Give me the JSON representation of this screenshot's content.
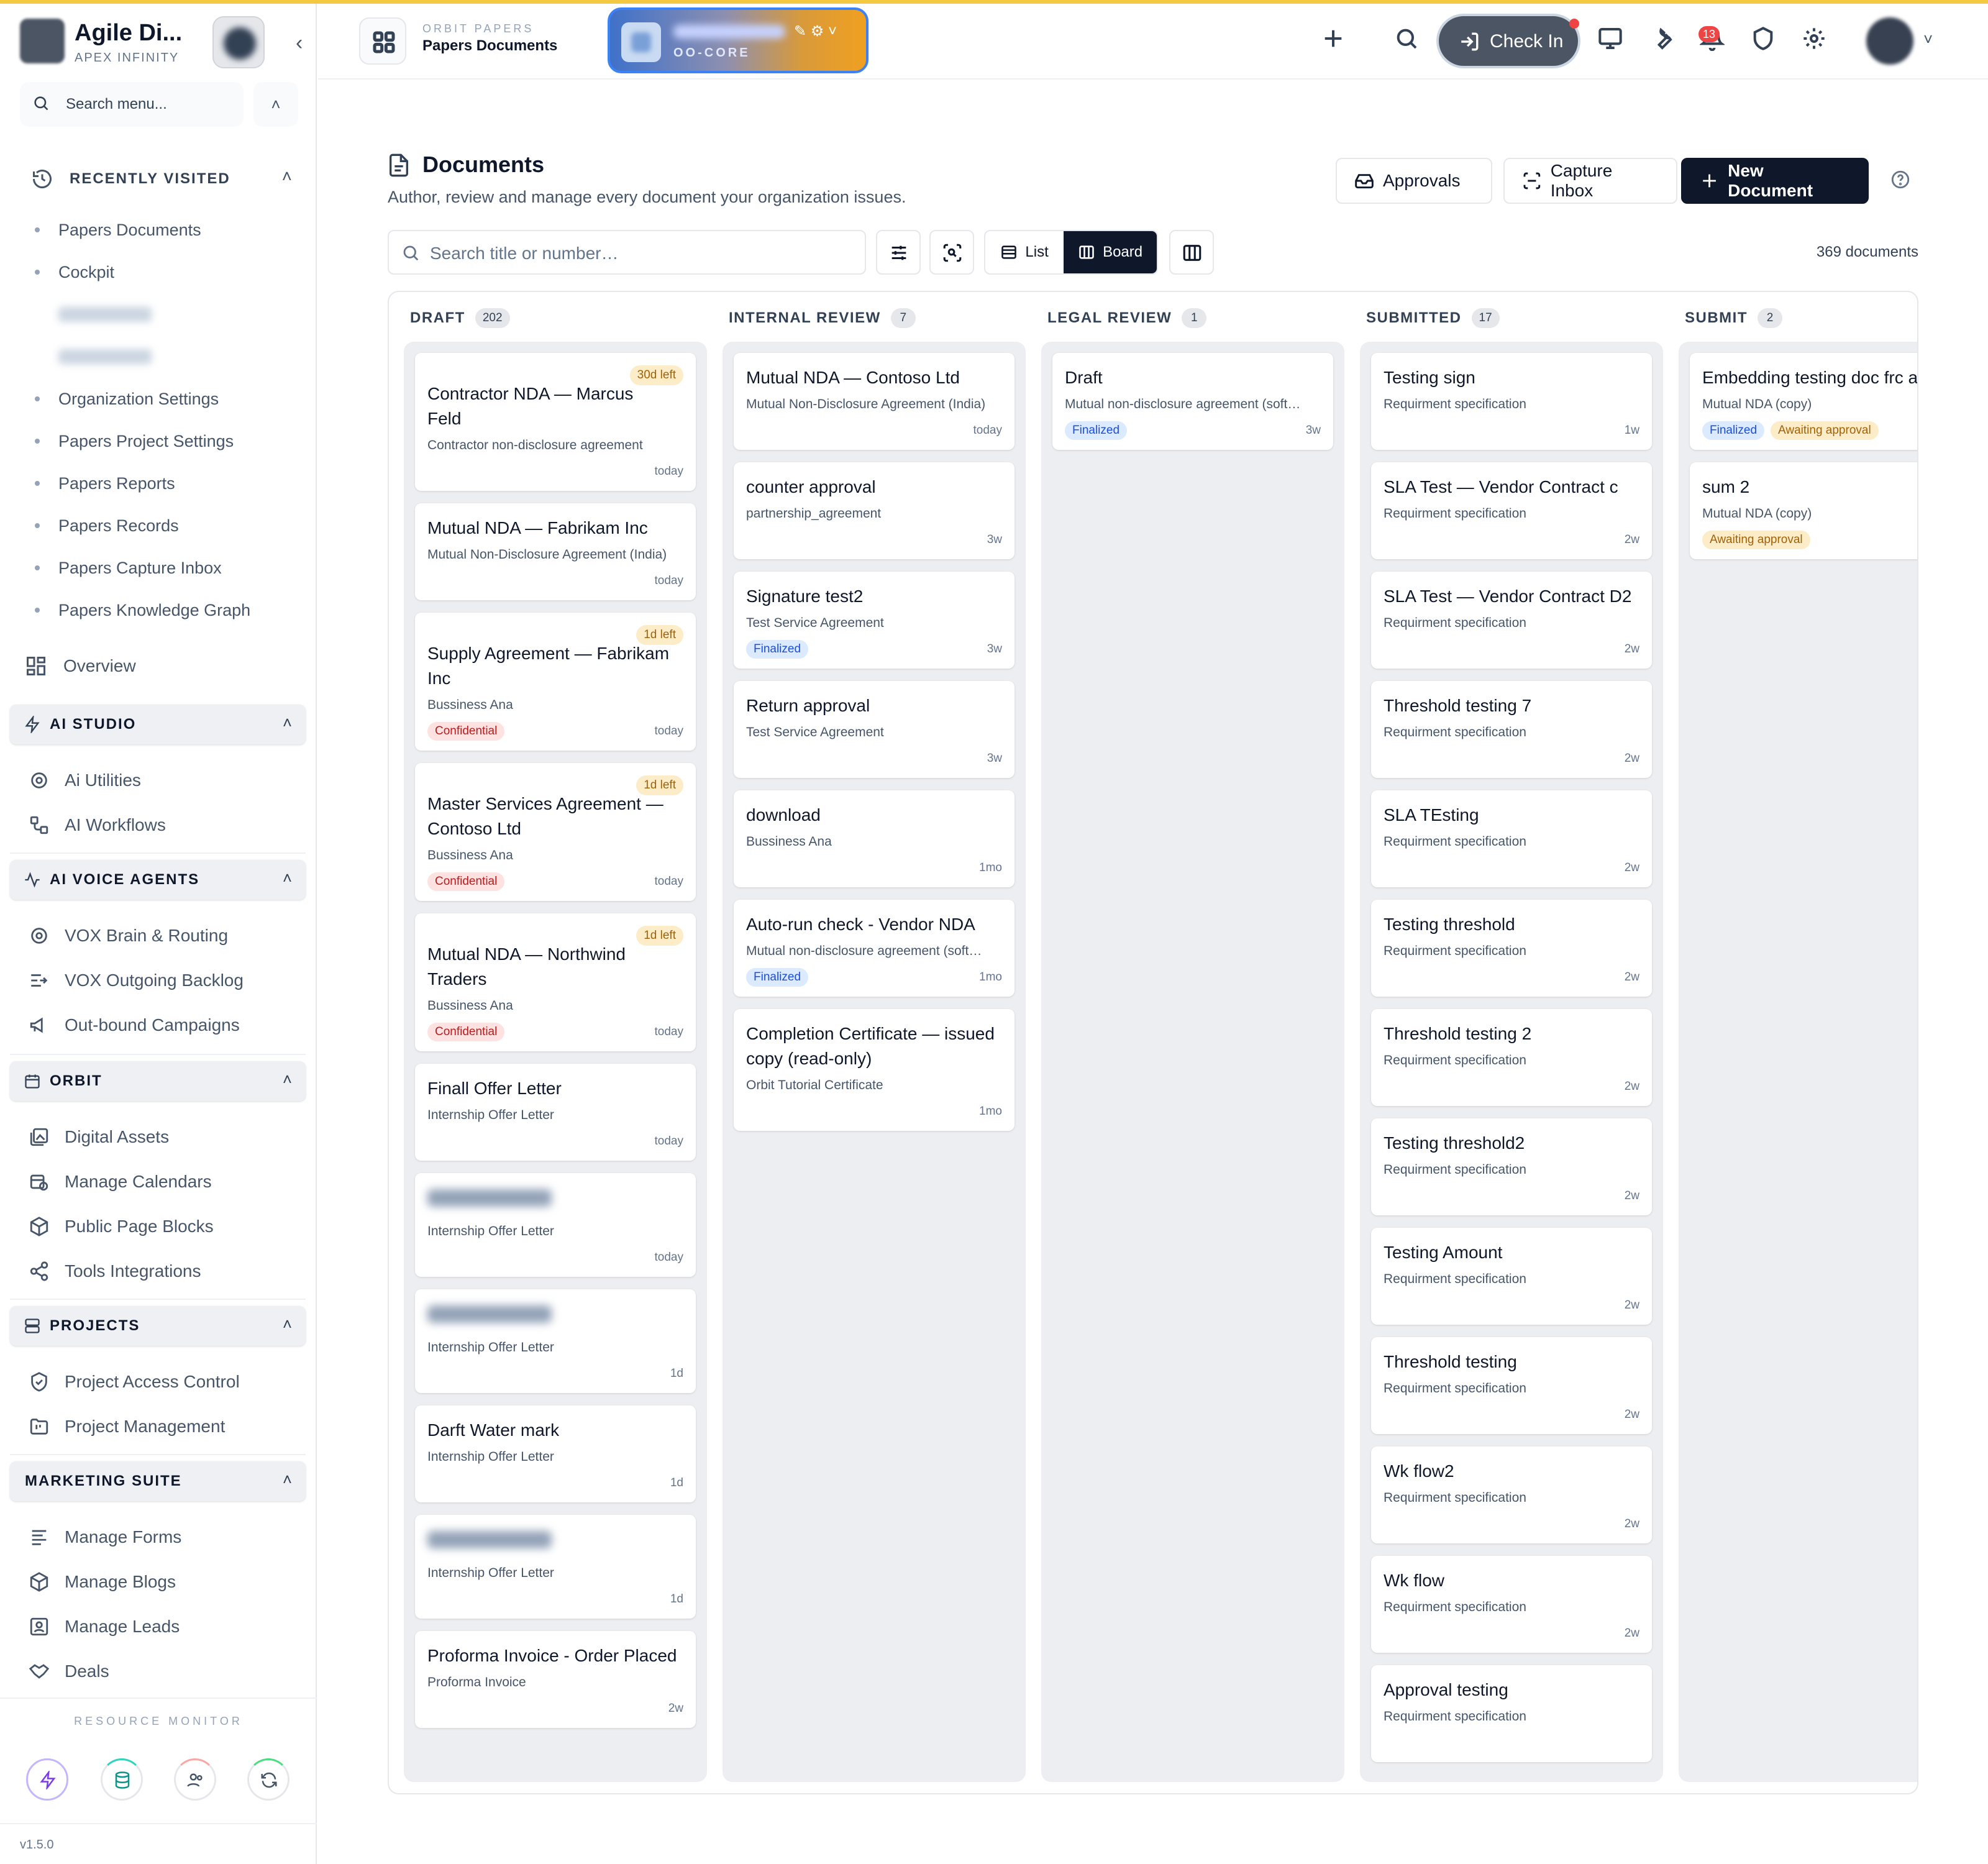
{
  "brand": {
    "name": "Agile Di...",
    "subtitle": "APEX INFINITY"
  },
  "sidebar": {
    "search_placeholder": "Search menu...",
    "recent_label": "RECENTLY VISITED",
    "recent": [
      "Papers Documents",
      "Cockpit",
      "",
      "",
      "Organization Settings",
      "Papers Project Settings",
      "Papers Reports",
      "Papers Records",
      "Papers Capture Inbox",
      "Papers Knowledge Graph"
    ],
    "overview": "Overview",
    "sections": [
      {
        "label": "AI STUDIO",
        "items": [
          "Ai Utilities",
          "AI Workflows"
        ]
      },
      {
        "label": "AI VOICE AGENTS",
        "items": [
          "VOX Brain & Routing",
          "VOX Outgoing Backlog",
          "Out-bound Campaigns"
        ]
      },
      {
        "label": "ORBIT",
        "items": [
          "Digital Assets",
          "Manage Calendars",
          "Public Page Blocks",
          "Tools Integrations"
        ]
      },
      {
        "label": "PROJECTS",
        "items": [
          "Project Access Control",
          "Project Management"
        ]
      },
      {
        "label": "MARKETING SUITE",
        "items": [
          "Manage Forms",
          "Manage Blogs",
          "Manage Leads",
          "Deals"
        ]
      }
    ],
    "resource_monitor": "RESOURCE MONITOR",
    "version": "v1.5.0"
  },
  "topbar": {
    "app_kicker": "ORBIT PAPERS",
    "app_title": "Papers Documents",
    "workspace_code": "OO-CORE",
    "checkin_label": "Check In",
    "notif_count": "13"
  },
  "page": {
    "title": "Documents",
    "subtitle": "Author, review and manage every document your organization issues.",
    "approvals": "Approvals",
    "capture_inbox": "Capture Inbox",
    "new_document": "New Document",
    "search_placeholder": "Search title or number…",
    "view_list": "List",
    "view_board": "Board",
    "doc_count": "369 documents"
  },
  "colors": {
    "accent": "#0f172a",
    "topline": "#f5c842",
    "badge": "#ef4444"
  },
  "board": {
    "columns": [
      {
        "name": "DRAFT",
        "count": "202",
        "cards": [
          {
            "due": "30d left",
            "title": "Contractor NDA — Marcus Feld",
            "template": "Contractor non-disclosure agreement",
            "tags": [],
            "time": "today"
          },
          {
            "due": "",
            "title": "Mutual NDA — Fabrikam Inc",
            "template": "Mutual Non-Disclosure Agreement (India)",
            "tags": [],
            "time": "today"
          },
          {
            "due": "1d left",
            "title": "Supply Agreement — Fabrikam Inc",
            "template": "Bussiness Ana",
            "tags": [
              "Confidential"
            ],
            "time": "today"
          },
          {
            "due": "1d left",
            "title": "Master Services Agreement — Contoso Ltd",
            "template": "Bussiness Ana",
            "tags": [
              "Confidential"
            ],
            "time": "today"
          },
          {
            "due": "1d left",
            "title": "Mutual NDA — Northwind Traders",
            "template": "Bussiness Ana",
            "tags": [
              "Confidential"
            ],
            "time": "today"
          },
          {
            "due": "",
            "title": "Finall Offer Letter",
            "template": "Internship Offer Letter",
            "tags": [],
            "time": "today"
          },
          {
            "due": "",
            "title": "",
            "template": "Internship Offer Letter",
            "tags": [],
            "time": "today"
          },
          {
            "due": "",
            "title": "",
            "template": "Internship Offer Letter",
            "tags": [],
            "time": "1d"
          },
          {
            "due": "",
            "title": "Darft Water mark",
            "template": "Internship Offer Letter",
            "tags": [],
            "time": "1d"
          },
          {
            "due": "",
            "title": "",
            "template": "Internship Offer Letter",
            "tags": [],
            "time": "1d"
          },
          {
            "due": "",
            "title": "Proforma Invoice - Order Placed",
            "template": "Proforma Invoice",
            "tags": [],
            "time": "2w"
          }
        ]
      },
      {
        "name": "INTERNAL REVIEW",
        "count": "7",
        "cards": [
          {
            "due": "",
            "title": "Mutual NDA — Contoso Ltd",
            "template": "Mutual Non-Disclosure Agreement (India)",
            "tags": [],
            "time": "today"
          },
          {
            "due": "",
            "title": "counter approval",
            "template": "partnership_agreement",
            "tags": [],
            "time": "3w"
          },
          {
            "due": "",
            "title": "Signature test2",
            "template": "Test Service Agreement",
            "tags": [
              "Finalized"
            ],
            "time": "3w"
          },
          {
            "due": "",
            "title": "Return approval",
            "template": "Test Service Agreement",
            "tags": [],
            "time": "3w"
          },
          {
            "due": "",
            "title": "download",
            "template": "Bussiness Ana",
            "tags": [],
            "time": "1mo"
          },
          {
            "due": "",
            "title": "Auto-run check - Vendor NDA",
            "template": "Mutual non-disclosure agreement (soft…",
            "tags": [
              "Finalized"
            ],
            "time": "1mo"
          },
          {
            "due": "",
            "title": "Completion Certificate — issued copy (read-only)",
            "template": "Orbit Tutorial Certificate",
            "tags": [],
            "time": "1mo"
          }
        ]
      },
      {
        "name": "LEGAL REVIEW",
        "count": "1",
        "cards": [
          {
            "due": "",
            "title": "Draft",
            "template": "Mutual non-disclosure agreement (soft…",
            "tags": [
              "Finalized"
            ],
            "time": "3w"
          }
        ]
      },
      {
        "name": "SUBMITTED",
        "count": "17",
        "cards": [
          {
            "due": "",
            "title": "Testing sign",
            "template": "Requirment specification",
            "tags": [],
            "time": "1w"
          },
          {
            "due": "",
            "title": "SLA Test — Vendor Contract c",
            "template": "Requirment specification",
            "tags": [],
            "time": "2w"
          },
          {
            "due": "",
            "title": "SLA Test — Vendor Contract D2",
            "template": "Requirment specification",
            "tags": [],
            "time": "2w"
          },
          {
            "due": "",
            "title": "Threshold testing 7",
            "template": "Requirment specification",
            "tags": [],
            "time": "2w"
          },
          {
            "due": "",
            "title": "SLA TEsting",
            "template": "Requirment specification",
            "tags": [],
            "time": "2w"
          },
          {
            "due": "",
            "title": "Testing threshold",
            "template": "Requirment specification",
            "tags": [],
            "time": "2w"
          },
          {
            "due": "",
            "title": "Threshold testing 2",
            "template": "Requirment specification",
            "tags": [],
            "time": "2w"
          },
          {
            "due": "",
            "title": "Testing threshold2",
            "template": "Requirment specification",
            "tags": [],
            "time": "2w"
          },
          {
            "due": "",
            "title": "Testing Amount",
            "template": "Requirment specification",
            "tags": [],
            "time": "2w"
          },
          {
            "due": "",
            "title": "Threshold testing",
            "template": "Requirment specification",
            "tags": [],
            "time": "2w"
          },
          {
            "due": "",
            "title": "Wk flow2",
            "template": "Requirment specification",
            "tags": [],
            "time": "2w"
          },
          {
            "due": "",
            "title": "Wk flow",
            "template": "Requirment specification",
            "tags": [],
            "time": "2w"
          },
          {
            "due": "",
            "title": "Approval testing",
            "template": "Requirment specification",
            "tags": [],
            "time": ""
          }
        ]
      },
      {
        "name": "SUBMIT",
        "count": "2",
        "cards": [
          {
            "due": "",
            "title": "Embedding testing doc frc apilab",
            "template": "Mutual NDA (copy)",
            "tags": [
              "Finalized",
              "Awaiting approval"
            ],
            "time": ""
          },
          {
            "due": "",
            "title": "sum 2",
            "template": "Mutual NDA (copy)",
            "tags": [
              "Awaiting approval"
            ],
            "time": ""
          }
        ]
      }
    ]
  }
}
